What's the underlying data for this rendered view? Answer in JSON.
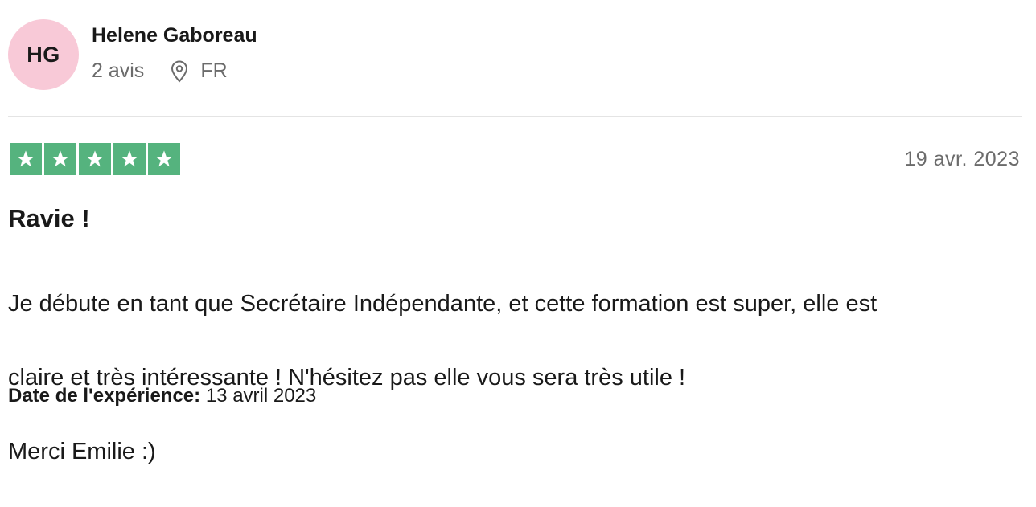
{
  "reviewer": {
    "initials": "HG",
    "avatar_color": "#f8c9d7",
    "name": "Helene Gaboreau",
    "reviews_count": "2 avis",
    "location_icon": "map-pin-icon",
    "country": "FR"
  },
  "review": {
    "rating": 5,
    "rating_max": 5,
    "star_color": "#55b37e",
    "date": "19 avr. 2023",
    "title": "Ravie !",
    "body_lines": [
      "Je débute en tant que Secrétaire Indépendante, et cette formation est super, elle est",
      "claire et très intéressante ! N'hésitez pas elle vous sera très utile !",
      "Merci Emilie :)"
    ],
    "experience_label": "Date de l'expérience:",
    "experience_date": "13 avril 2023"
  }
}
